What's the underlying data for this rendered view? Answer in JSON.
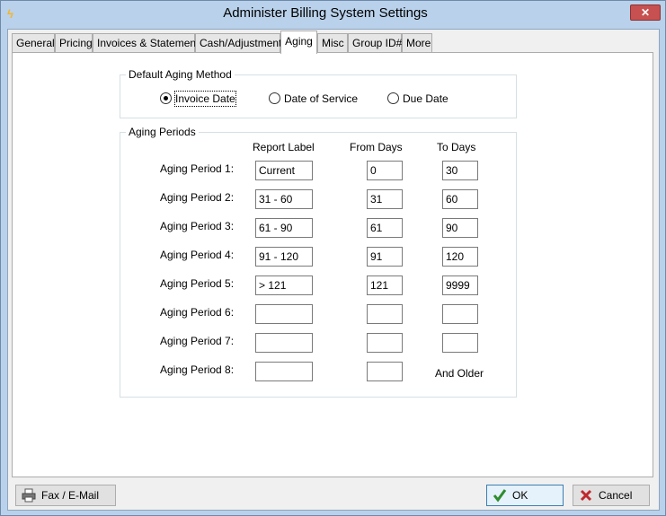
{
  "window": {
    "title": "Administer Billing System Settings",
    "close_label": "✕"
  },
  "tabs": [
    {
      "label": "General"
    },
    {
      "label": "Pricing"
    },
    {
      "label": "Invoices & Statements"
    },
    {
      "label": "Cash/Adjustments"
    },
    {
      "label": "Aging",
      "active": true
    },
    {
      "label": "Misc"
    },
    {
      "label": "Group ID#"
    },
    {
      "label": "More"
    }
  ],
  "default_aging_method": {
    "title": "Default Aging Method",
    "options": [
      {
        "label": "Invoice Date",
        "selected": true
      },
      {
        "label": "Date of Service",
        "selected": false
      },
      {
        "label": "Due Date",
        "selected": false
      }
    ]
  },
  "aging_periods": {
    "title": "Aging Periods",
    "headers": {
      "report_label": "Report Label",
      "from_days": "From Days",
      "to_days": "To Days"
    },
    "rows": [
      {
        "label": "Aging Period 1:",
        "report_label": "Current",
        "from_days": "0",
        "to_days": "30"
      },
      {
        "label": "Aging Period 2:",
        "report_label": "31 - 60",
        "from_days": "31",
        "to_days": "60"
      },
      {
        "label": "Aging Period 3:",
        "report_label": "61 - 90",
        "from_days": "61",
        "to_days": "90"
      },
      {
        "label": "Aging Period 4:",
        "report_label": "91 - 120",
        "from_days": "91",
        "to_days": "120"
      },
      {
        "label": "Aging Period 5:",
        "report_label": "> 121",
        "from_days": "121",
        "to_days": "9999"
      },
      {
        "label": "Aging Period 6:",
        "report_label": "",
        "from_days": "",
        "to_days": ""
      },
      {
        "label": "Aging Period 7:",
        "report_label": "",
        "from_days": "",
        "to_days": ""
      },
      {
        "label": "Aging Period 8:",
        "report_label": "",
        "from_days": "",
        "to_days": ""
      }
    ],
    "and_older": "And Older"
  },
  "buttons": {
    "fax_email": "Fax / E-Mail",
    "ok": "OK",
    "cancel": "Cancel"
  },
  "colors": {
    "window_frame": "#b9d1ea",
    "close_button": "#c75050",
    "ok_check": "#2e8b2e",
    "cancel_x": "#c0282d"
  }
}
